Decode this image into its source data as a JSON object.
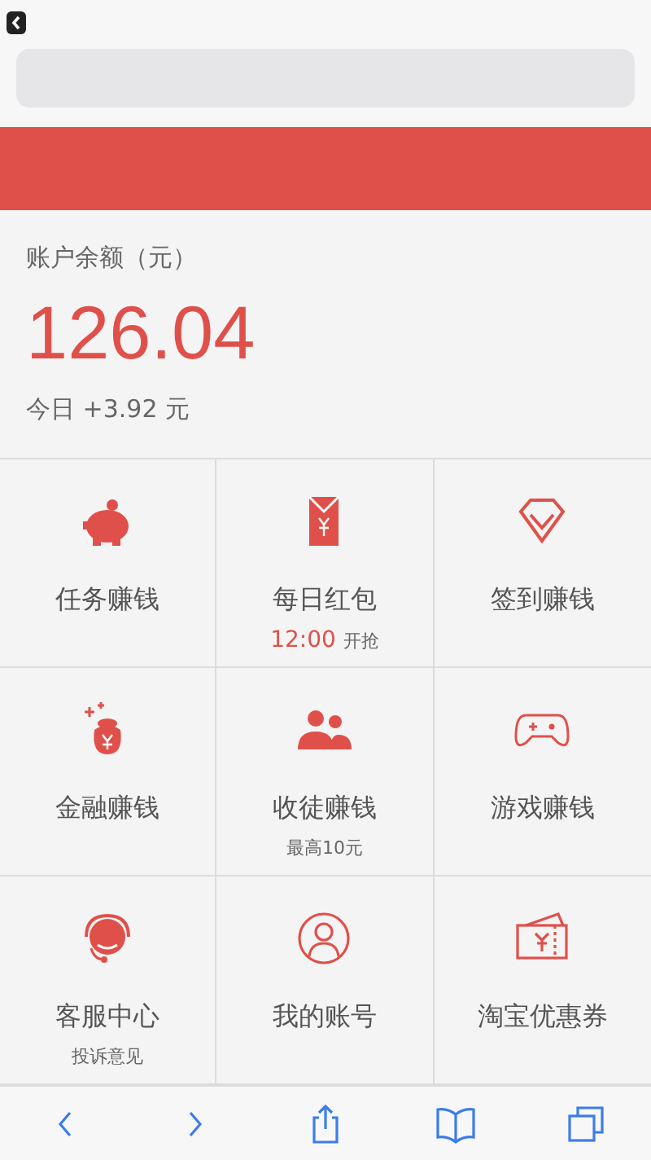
{
  "balance": {
    "label": "账户余额（元）",
    "amount": "126.04",
    "today": "今日 +3.92 元"
  },
  "grid": [
    {
      "label": "任务赚钱"
    },
    {
      "label": "每日红包",
      "note_highlight": "12:00",
      "note": "开抢"
    },
    {
      "label": "签到赚钱"
    },
    {
      "label": "金融赚钱"
    },
    {
      "label": "收徒赚钱",
      "note": "最高10元"
    },
    {
      "label": "游戏赚钱"
    },
    {
      "label": "客服中心",
      "note": "投诉意见"
    },
    {
      "label": "我的账号"
    },
    {
      "label": "淘宝优惠券"
    }
  ]
}
